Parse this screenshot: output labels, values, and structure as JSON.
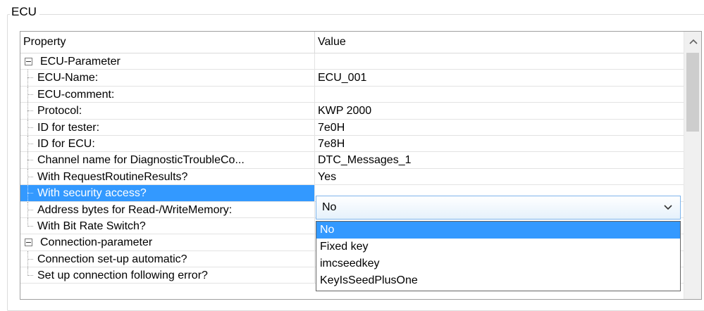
{
  "groupbox": {
    "title": "ECU"
  },
  "grid": {
    "columns": [
      "Property",
      "Value"
    ],
    "rows": [
      {
        "type": "group",
        "label": "ECU-Parameter",
        "value": "",
        "expanded": true
      },
      {
        "type": "child",
        "label": "ECU-Name:",
        "value": "ECU_001"
      },
      {
        "type": "child",
        "label": "ECU-comment:",
        "value": ""
      },
      {
        "type": "child",
        "label": "Protocol:",
        "value": "KWP 2000"
      },
      {
        "type": "child",
        "label": "ID for tester:",
        "value": "7e0H"
      },
      {
        "type": "child",
        "label": "ID for ECU:",
        "value": "7e8H"
      },
      {
        "type": "child",
        "label": "Channel name for DiagnosticTroubleCo...",
        "value": "DTC_Messages_1"
      },
      {
        "type": "child",
        "label": "With RequestRoutineResults?",
        "value": "Yes"
      },
      {
        "type": "child",
        "label": "With security access?",
        "value": "",
        "selected": true
      },
      {
        "type": "child",
        "label": "Address bytes for Read-/WriteMemory:",
        "value": ""
      },
      {
        "type": "child",
        "label": "With Bit Rate Switch?",
        "value": ""
      },
      {
        "type": "group",
        "label": "Connection-parameter",
        "value": "",
        "expanded": true
      },
      {
        "type": "child",
        "label": "Connection set-up automatic?",
        "value": ""
      },
      {
        "type": "child",
        "label": "Set up connection following error?",
        "value": ""
      }
    ]
  },
  "combo": {
    "value": "No"
  },
  "dropdown": {
    "options": [
      "No",
      "Fixed key",
      "imcseedkey",
      "KeyIsSeedPlusOne"
    ],
    "selected_index": 0
  },
  "colors": {
    "selection": "#3399ff",
    "combo_border": "#7eb4ea"
  },
  "icons": {
    "expander": "minus-box-icon",
    "scroll_up": "chevron-up-icon",
    "combo_arrow": "chevron-down-icon"
  }
}
